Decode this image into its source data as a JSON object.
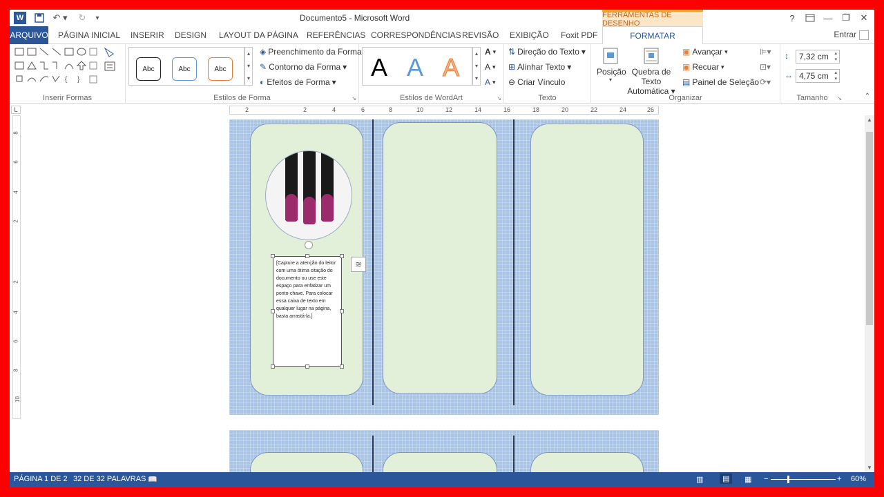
{
  "titlebar": {
    "title": "Documento5 - Microsoft Word",
    "context_tab_title": "FERRAMENTAS DE DESENHO",
    "help": "?",
    "minimize": "—",
    "restore": "❐",
    "close": "✕",
    "word_icon": "W"
  },
  "tabs": {
    "arquivo": "ARQUIVO",
    "items": [
      "PÁGINA INICIAL",
      "INSERIR",
      "DESIGN",
      "LAYOUT DA PÁGINA",
      "REFERÊNCIAS",
      "CORRESPONDÊNCIAS",
      "REVISÃO",
      "EXIBIÇÃO",
      "Foxit PDF"
    ],
    "formatar": "FORMATAR",
    "entrar": "Entrar"
  },
  "ribbon": {
    "inserir_formas": {
      "label": "Inserir Formas"
    },
    "estilos_forma": {
      "label": "Estilos de Forma",
      "gallery": [
        "Abc",
        "Abc",
        "Abc"
      ],
      "fill": "Preenchimento da Forma",
      "outline": "Contorno da Forma",
      "effects": "Efeitos de Forma"
    },
    "wordart": {
      "label": "Estilos de WordArt",
      "letters": [
        "A",
        "A",
        "A"
      ]
    },
    "texto": {
      "label": "Texto",
      "direction": "Direção do Texto",
      "align": "Alinhar Texto",
      "link": "Criar Vínculo"
    },
    "organizar": {
      "label": "Organizar",
      "position": "Posição",
      "wrap_line1": "Quebra de Texto",
      "wrap_line2": "Automática",
      "forward": "Avançar",
      "backward": "Recuar",
      "pane": "Painel de Seleção"
    },
    "tamanho": {
      "label": "Tamanho",
      "height": "7,32 cm",
      "width": "4,75 cm"
    }
  },
  "ruler": {
    "h_ticks": [
      "2",
      "2",
      "4",
      "6",
      "8",
      "10",
      "12",
      "14",
      "16",
      "18",
      "20",
      "22",
      "24",
      "26"
    ],
    "v_ticks": [
      "8",
      "6",
      "4",
      "2",
      "2",
      "4",
      "6",
      "8",
      "10"
    ],
    "corner": "L"
  },
  "document": {
    "quote_text": "[Capture a atenção do leitor com uma ótima citação do documento ou use este espaço para enfatizar um ponto-chave. Para colocar essa caixa de texto em qualquer lugar na página, basta arrastá-la.]"
  },
  "status": {
    "page": "PÁGINA 1 DE 2",
    "words": "32 DE 32 PALAVRAS",
    "zoom": "60%",
    "minus": "−",
    "plus": "+"
  },
  "colors": {
    "accent": "#2b579a",
    "page_bg": "#a9c4e4",
    "panel_fill": "#e2f0d9",
    "frame": "#ff0000"
  }
}
